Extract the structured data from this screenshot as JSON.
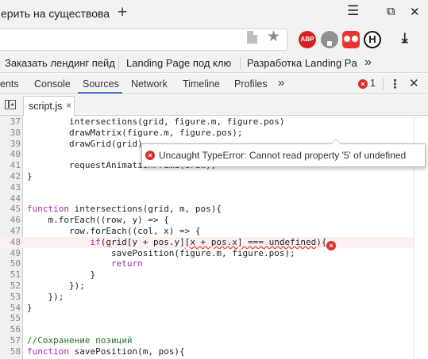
{
  "browser": {
    "tab_title": "ерить на существован",
    "new_tab_glyph": "+",
    "window_controls": {
      "menu": "☰",
      "restore": "⧉",
      "close": "✕"
    },
    "toolbar": {
      "star": "★",
      "abp_label": "ABP",
      "ext4_label": "H",
      "download": "⤓"
    }
  },
  "bookmarks": {
    "items": [
      {
        "label": "Заказать лендинг пейд"
      },
      {
        "label": "Landing Page под клю"
      },
      {
        "label": "Разработка Landing Pa"
      }
    ],
    "more": "»"
  },
  "devtools": {
    "tabs": [
      {
        "label": "ents"
      },
      {
        "label": "Console"
      },
      {
        "label": "Sources"
      },
      {
        "label": "Network"
      },
      {
        "label": "Timeline"
      },
      {
        "label": "Profiles"
      }
    ],
    "active_tab": "Sources",
    "more_tabs": "»",
    "error_count": "1",
    "menu_glyph": "⋮",
    "close_glyph": "✕"
  },
  "sources": {
    "open_file": "script.js",
    "close_glyph": "×"
  },
  "editor": {
    "lines": [
      {
        "n": "37",
        "t": "        intersections(grid, figure.m, figure.pos)"
      },
      {
        "n": "38",
        "t": "        drawMatrix(figure.m, figure.pos);"
      },
      {
        "n": "39",
        "t": "        drawGrid(grid)"
      },
      {
        "n": "40",
        "t": ""
      },
      {
        "n": "41",
        "t": "        requestAnimationFrame(draw);"
      },
      {
        "n": "42",
        "t": "}"
      },
      {
        "n": "43",
        "t": ""
      },
      {
        "n": "44",
        "t": ""
      },
      {
        "n": "45",
        "t": "function intersections(grid, m, pos){"
      },
      {
        "n": "46",
        "t": "    m.forEach((row, y) => {"
      },
      {
        "n": "47",
        "t": "        row.forEach((col, x) => {"
      },
      {
        "n": "48",
        "t": "            if(grid[y + pos.y][x + pos.x] === undefined){"
      },
      {
        "n": "49",
        "t": "                savePosition(figure.m, figure.pos);"
      },
      {
        "n": "50",
        "t": "                return"
      },
      {
        "n": "51",
        "t": "            }"
      },
      {
        "n": "52",
        "t": "        });"
      },
      {
        "n": "53",
        "t": "    });"
      },
      {
        "n": "54",
        "t": "}"
      },
      {
        "n": "55",
        "t": ""
      },
      {
        "n": "56",
        "t": ""
      },
      {
        "n": "57",
        "t": "//Сохранение позиций"
      },
      {
        "n": "58",
        "t": "function savePosition(m, pos){"
      }
    ],
    "error_line": "48",
    "error_message": "Uncaught TypeError: Cannot read property '5' of undefined"
  },
  "colors": {
    "keyword": "#a626a4",
    "comment": "#236e25",
    "error": "#d9302c",
    "active_tab_underline": "#3879d9"
  }
}
